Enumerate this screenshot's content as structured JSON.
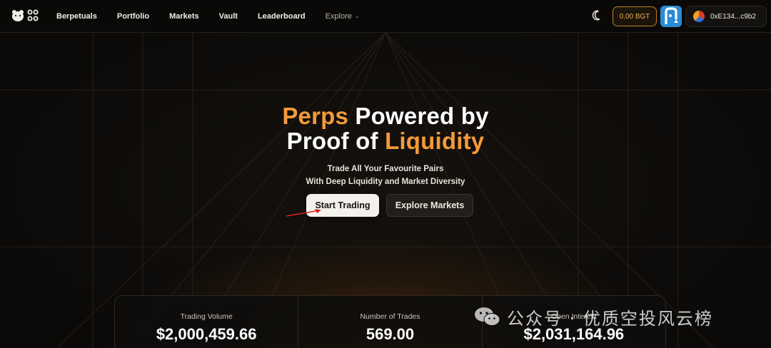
{
  "nav": {
    "items": [
      {
        "label": "Berpetuals"
      },
      {
        "label": "Portfolio"
      },
      {
        "label": "Markets"
      },
      {
        "label": "Vault"
      },
      {
        "label": "Leaderboard"
      },
      {
        "label": "Explore"
      }
    ],
    "bgt_balance": "0.00 BGT",
    "wallet_address": "0xE134...c9b2",
    "theme_icon": "moon-icon",
    "logo_icon": "bear-logo-icon"
  },
  "hero": {
    "title_line1_accent": "Perps",
    "title_line1_rest": " Powered by",
    "title_line2_prefix": "Proof of ",
    "title_line2_accent": "Liquidity",
    "subtitle_line1": "Trade All Your Favourite Pairs",
    "subtitle_line2": "With Deep Liquidity and Market Diversity",
    "start_button": "Start Trading",
    "explore_button": "Explore Markets"
  },
  "stats": [
    {
      "label": "Trading Volume",
      "value": "$2,000,459.66"
    },
    {
      "label": "Number of Trades",
      "value": "569.00"
    },
    {
      "label": "Open Interest",
      "value": "$2,031,164.96"
    }
  ],
  "watermark": {
    "text": "公众号 · 优质空投风云榜"
  },
  "colors": {
    "accent_orange": "#f39a3a",
    "bgt_gold": "#e8b352",
    "background": "#0a0908"
  }
}
